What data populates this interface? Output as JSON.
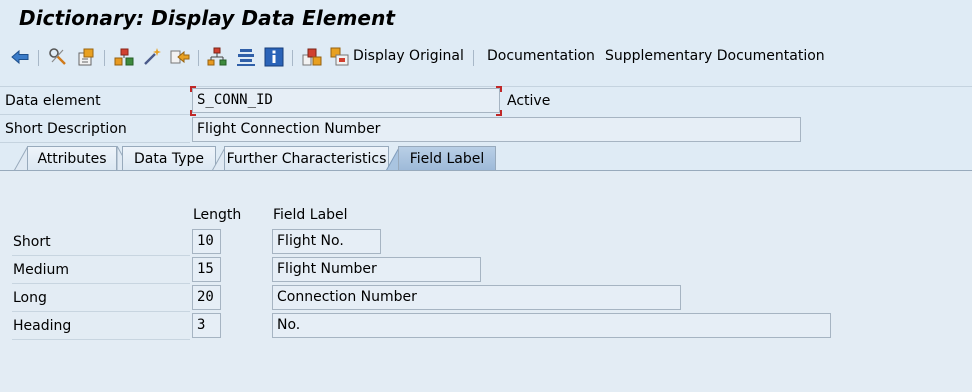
{
  "window": {
    "title": "Dictionary: Display Data Element"
  },
  "toolbar": {
    "display_original_label": "Display Original",
    "documentation_label": "Documentation",
    "supplementary_documentation_label": "Supplementary Documentation",
    "icons": [
      "back-icon",
      "display-change-icon",
      "activate-icon",
      "where-used-icon",
      "magic-wand-icon",
      "navigate-icon",
      "hierarchy-icon",
      "list-icon",
      "info-icon",
      "other-object-icon",
      "display-original-icon"
    ]
  },
  "header": {
    "data_element_label": "Data element",
    "data_element_value": "S_CONN_ID",
    "status": "Active",
    "short_description_label": "Short Description",
    "short_description_value": "Flight Connection Number"
  },
  "tabs": [
    {
      "label": "Attributes",
      "active": false
    },
    {
      "label": "Data Type",
      "active": false
    },
    {
      "label": "Further Characteristics",
      "active": false
    },
    {
      "label": "Field Label",
      "active": true
    }
  ],
  "field_labels": {
    "length_header": "Length",
    "label_header": "Field Label",
    "rows": [
      {
        "name": "Short",
        "length": "10",
        "label": "Flight No."
      },
      {
        "name": "Medium",
        "length": "15",
        "label": "Flight Number"
      },
      {
        "name": "Long",
        "length": "20",
        "label": "Connection Number"
      },
      {
        "name": "Heading",
        "length": "3",
        "label": "No."
      }
    ]
  },
  "colors": {
    "background": "#dfebf5",
    "field_background": "#e6eef6",
    "active_tab": "#a9c4e0",
    "focus_corner": "#c02828"
  }
}
